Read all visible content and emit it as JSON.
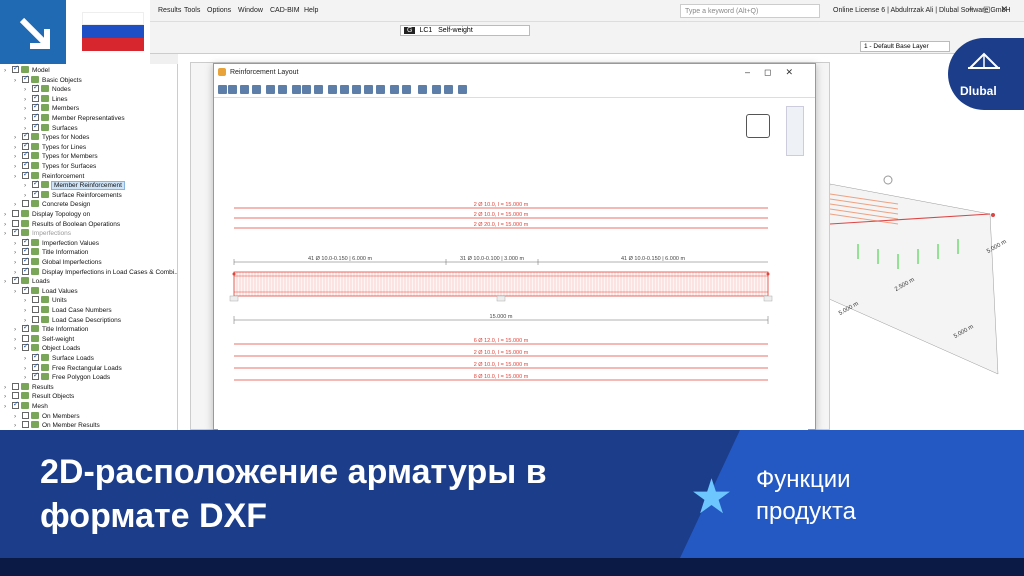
{
  "menu": {
    "items": [
      "Results",
      "Tools",
      "Options",
      "Window",
      "CAD-BIM",
      "Help"
    ],
    "search_placeholder": "Type a keyword (Alt+Q)",
    "license": "Online License 6 | Abdulrrzak Ali | Dlubal Software GmbH"
  },
  "toolbar": {
    "lc_tag": "G",
    "lc_id": "LC1",
    "lc_name": "Self-weight",
    "layer": "1 - Default Base Layer"
  },
  "tree": {
    "items": [
      {
        "label": "Model",
        "level": 0,
        "checked": true
      },
      {
        "label": "Basic Objects",
        "level": 1,
        "checked": true
      },
      {
        "label": "Nodes",
        "level": 2,
        "checked": true
      },
      {
        "label": "Lines",
        "level": 2,
        "checked": true
      },
      {
        "label": "Members",
        "level": 2,
        "checked": true
      },
      {
        "label": "Member Representatives",
        "level": 2,
        "checked": true
      },
      {
        "label": "Surfaces",
        "level": 2,
        "checked": true
      },
      {
        "label": "Types for Nodes",
        "level": 1,
        "checked": true
      },
      {
        "label": "Types for Lines",
        "level": 1,
        "checked": true
      },
      {
        "label": "Types for Members",
        "level": 1,
        "checked": true
      },
      {
        "label": "Types for Surfaces",
        "level": 1,
        "checked": true
      },
      {
        "label": "Reinforcement",
        "level": 1,
        "checked": true
      },
      {
        "label": "Member Reinforcement",
        "level": 2,
        "checked": true,
        "selected": true
      },
      {
        "label": "Surface Reinforcements",
        "level": 2,
        "checked": true
      },
      {
        "label": "Concrete Design",
        "level": 1,
        "checked": false
      },
      {
        "label": "Display Topology on",
        "level": 0,
        "checked": false
      },
      {
        "label": "Results of Boolean Operations",
        "level": 0,
        "checked": false
      },
      {
        "label": "Imperfections",
        "level": 0,
        "checked": true,
        "grey": true
      },
      {
        "label": "Imperfection Values",
        "level": 1,
        "checked": true
      },
      {
        "label": "Title Information",
        "level": 1,
        "checked": true
      },
      {
        "label": "Global Imperfections",
        "level": 1,
        "checked": true
      },
      {
        "label": "Display Imperfections in Load Cases & Combi...",
        "level": 1,
        "checked": true
      },
      {
        "label": "Loads",
        "level": 0,
        "checked": true
      },
      {
        "label": "Load Values",
        "level": 1,
        "checked": true
      },
      {
        "label": "Units",
        "level": 2,
        "checked": false
      },
      {
        "label": "Load Case Numbers",
        "level": 2,
        "checked": false
      },
      {
        "label": "Load Case Descriptions",
        "level": 2,
        "checked": false
      },
      {
        "label": "Title Information",
        "level": 1,
        "checked": true
      },
      {
        "label": "Self-weight",
        "level": 1,
        "checked": false
      },
      {
        "label": "Object Loads",
        "level": 1,
        "checked": true
      },
      {
        "label": "Surface Loads",
        "level": 2,
        "checked": true
      },
      {
        "label": "Free Rectangular Loads",
        "level": 2,
        "checked": true
      },
      {
        "label": "Free Polygon Loads",
        "level": 2,
        "checked": true
      },
      {
        "label": "Results",
        "level": 0,
        "checked": false
      },
      {
        "label": "Result Objects",
        "level": 0,
        "checked": false
      },
      {
        "label": "Mesh",
        "level": 0,
        "checked": true
      },
      {
        "label": "On Members",
        "level": 1,
        "checked": false
      },
      {
        "label": "On Member Results",
        "level": 1,
        "checked": false
      }
    ]
  },
  "view3d": {
    "dims": [
      "5.000 m",
      "5.000 m",
      "2.500 m",
      "5.000 m"
    ]
  },
  "dialog": {
    "title": "Reinforcement Layout",
    "top_bars": [
      "2 Ø 10.0, l = 15.000 m",
      "2 Ø 10.0, l = 15.000 m",
      "2 Ø 20.0, l = 15.000 m"
    ],
    "stirrups": [
      "41 Ø 10.0-0.150 | 6.000 m",
      "31 Ø 10.0-0.100 | 3.000 m",
      "41 Ø 10.0-0.150 | 6.000 m"
    ],
    "length": "15.000 m",
    "bottom_bars": [
      "6 Ø 12.0, l = 15.000 m",
      "2 Ø 10.0, l = 15.000 m",
      "2 Ø 10.0, l = 15.000 m",
      "8 Ø 10.0, l = 15.000 m"
    ]
  },
  "banner": {
    "title": "2D-расположение арматуры в формате DXF",
    "category": "Функции продукта"
  },
  "logo": {
    "text": "Dlubal"
  },
  "colors": {
    "accent": "#1f6ab3",
    "banner": "#1b3d8a",
    "banner_light": "#2459c4",
    "rebar": "#e0443a"
  }
}
